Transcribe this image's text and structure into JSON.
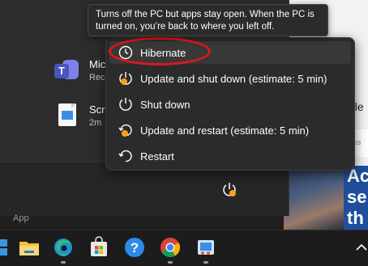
{
  "tooltip": {
    "line1": "Turns off the PC but apps stay open. When the PC is",
    "line2": "turned on, you’re back to where you left off."
  },
  "power_menu": {
    "items": [
      {
        "label": "Hibernate",
        "icon": "clock-icon"
      },
      {
        "label": "Update and shut down (estimate: 5 min)",
        "icon": "update-power-icon"
      },
      {
        "label": "Shut down",
        "icon": "power-icon"
      },
      {
        "label": "Update and restart (estimate: 5 min)",
        "icon": "update-restart-icon"
      },
      {
        "label": "Restart",
        "icon": "restart-icon"
      }
    ]
  },
  "recommended": [
    {
      "title": "Mic",
      "subtitle": "Rec",
      "icon": "teams-icon",
      "icon_letter": "T"
    },
    {
      "title": "Scre",
      "subtitle": "2m",
      "icon": "image-file-icon"
    }
  ],
  "start_footer": {
    "app_label": "App"
  },
  "background": {
    "text_right": "ale",
    "text_small": "RTIS",
    "ad_text": [
      "Ac",
      "se",
      "th"
    ]
  },
  "colors": {
    "accent_red": "#e0161c",
    "update_dot": "#f7a21b",
    "menu_bg": "#2b2b2b"
  },
  "taskbar": {
    "icons": [
      "start-icon",
      "file-explorer-icon",
      "edge-icon",
      "store-icon",
      "help-icon",
      "chrome-icon",
      "snipping-tool-icon"
    ],
    "tray": [
      "chevron-up-icon"
    ]
  }
}
